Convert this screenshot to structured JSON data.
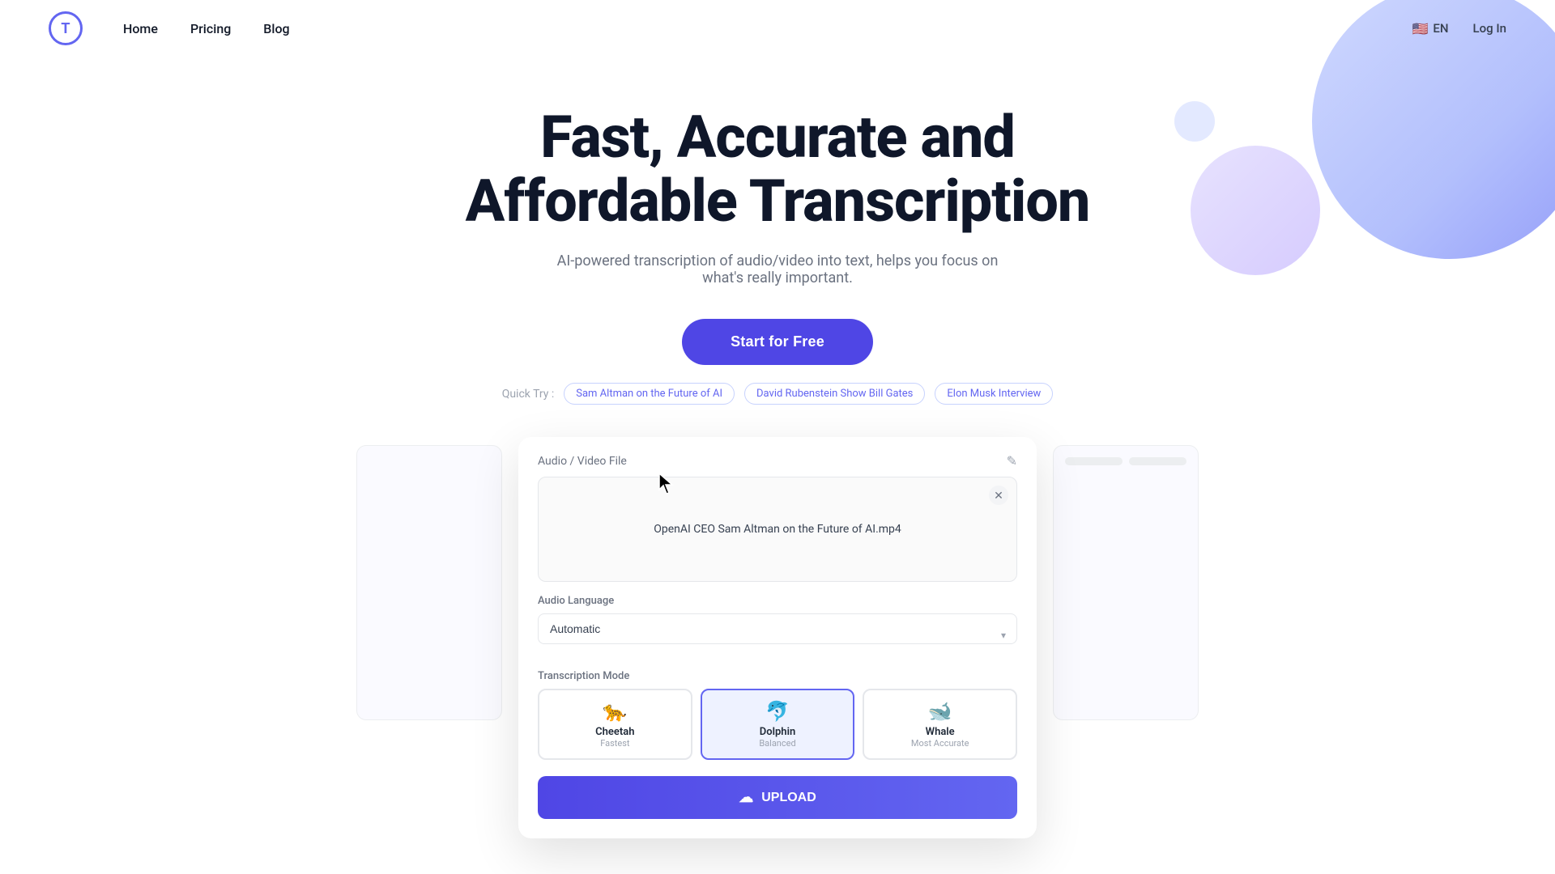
{
  "nav": {
    "logo_letter": "T",
    "links": [
      {
        "label": "Home",
        "id": "home"
      },
      {
        "label": "Pricing",
        "id": "pricing"
      },
      {
        "label": "Blog",
        "id": "blog"
      }
    ],
    "lang": "EN",
    "login": "Log In"
  },
  "hero": {
    "title_line1": "Fast, Accurate and",
    "title_line2": "Affordable Transcription",
    "subtitle": "AI-powered transcription of audio/video into text, helps you focus on what's really important.",
    "cta": "Start for Free",
    "quick_try_label": "Quick Try :",
    "chips": [
      "Sam Altman on the Future of AI",
      "David Rubenstein Show Bill Gates",
      "Elon Musk Interview"
    ]
  },
  "modal": {
    "file_header_label": "Audio / Video File",
    "file_name": "OpenAI CEO Sam Altman on the Future of AI.mp4",
    "language_label": "Audio Language",
    "language_value": "Automatic",
    "mode_label": "Transcription Mode",
    "modes": [
      {
        "emoji": "🐆",
        "name": "Cheetah",
        "desc": "Fastest",
        "active": false
      },
      {
        "emoji": "🐬",
        "name": "Dolphin",
        "desc": "Balanced",
        "active": true
      },
      {
        "emoji": "🐋",
        "name": "Whale",
        "desc": "Most Accurate",
        "active": false
      }
    ],
    "upload_btn": "UPLOAD"
  },
  "colors": {
    "primary": "#4f46e5",
    "active_border": "#6366f1",
    "active_bg": "#eef2ff"
  }
}
